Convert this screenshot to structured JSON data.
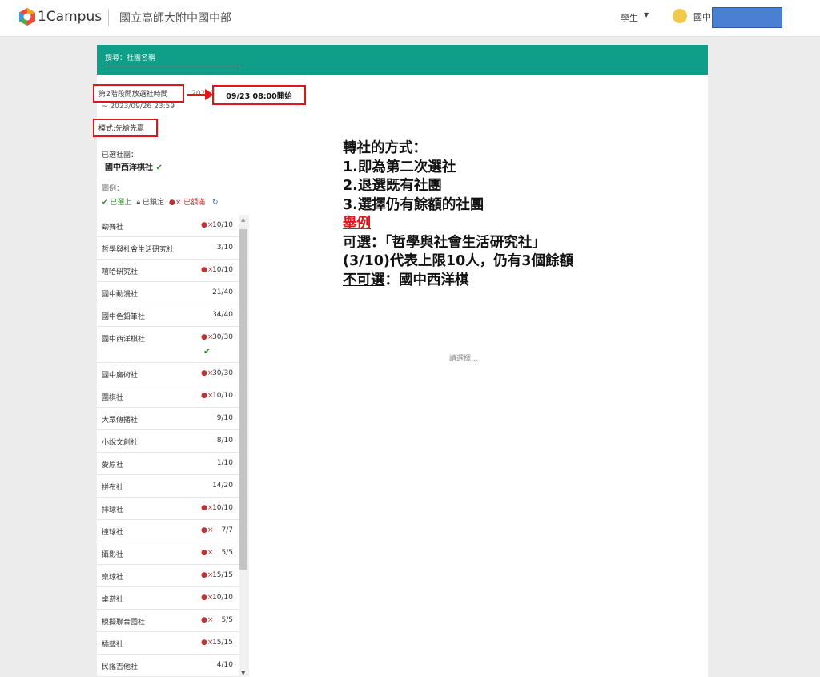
{
  "header": {
    "brand": "1Campus",
    "school": "國立高師大附中國中部",
    "role": "學生",
    "user_name": "國中",
    "colors": {
      "accent": "#0f9e88",
      "redaction": "#4a7fd3"
    }
  },
  "search": {
    "placeholder": "搜尋：社團名稱"
  },
  "period": {
    "label": "第2階段開放選社時間",
    "start_partial": "2023/",
    "end": "~ 2023/09/26 23:59",
    "callout": "09/23 08:00開始",
    "mode": "模式:先搶先贏"
  },
  "selected": {
    "label": "已選社團：",
    "club": "國中西洋棋社"
  },
  "legend": {
    "label": "圖例：",
    "selected": "已選上",
    "locked": "已鎖定",
    "full": "已額滿"
  },
  "clubs": [
    {
      "name": "勁舞社",
      "count": "10/10",
      "full": true
    },
    {
      "name": "哲學與社會生活研究社",
      "count": "3/10",
      "full": false
    },
    {
      "name": "嘻哈研究社",
      "count": "10/10",
      "full": true
    },
    {
      "name": "國中動漫社",
      "count": "21/40",
      "full": false
    },
    {
      "name": "國中色鉛筆社",
      "count": "34/40",
      "full": false
    },
    {
      "name": "國中西洋棋社",
      "count": "30/30",
      "full": true,
      "selected": true
    },
    {
      "name": "國中魔術社",
      "count": "30/30",
      "full": true
    },
    {
      "name": "圍棋社",
      "count": "10/10",
      "full": true
    },
    {
      "name": "大眾傳播社",
      "count": "9/10",
      "full": false
    },
    {
      "name": "小說文創社",
      "count": "8/10",
      "full": false
    },
    {
      "name": "愛原社",
      "count": "1/10",
      "full": false
    },
    {
      "name": "拼布社",
      "count": "14/20",
      "full": false
    },
    {
      "name": "排球社",
      "count": "10/10",
      "full": true
    },
    {
      "name": "撞球社",
      "count": "7/7",
      "full": true
    },
    {
      "name": "攝影社",
      "count": "5/5",
      "full": true
    },
    {
      "name": "桌球社",
      "count": "15/15",
      "full": true
    },
    {
      "name": "桌遊社",
      "count": "10/10",
      "full": true
    },
    {
      "name": "模擬聯合國社",
      "count": "5/5",
      "full": true
    },
    {
      "name": "橋藝社",
      "count": "15/15",
      "full": true
    },
    {
      "name": "民謠吉他社",
      "count": "4/10",
      "full": false
    }
  ],
  "annotation": {
    "l1": "轉社的方式：",
    "l2": "1.即為第二次選社",
    "l3": "2.退選既有社團",
    "l4": "3.選擇仍有餘額的社團",
    "l5": "舉例",
    "l6a": "可選",
    "l6b": "：「哲學與社會生活研究社」",
    "l7": "(3/10)代表上限10人，仍有3個餘額",
    "l8a": "不可選",
    "l8b": "：國中西洋棋"
  },
  "main": {
    "prompt": "請選擇..."
  }
}
